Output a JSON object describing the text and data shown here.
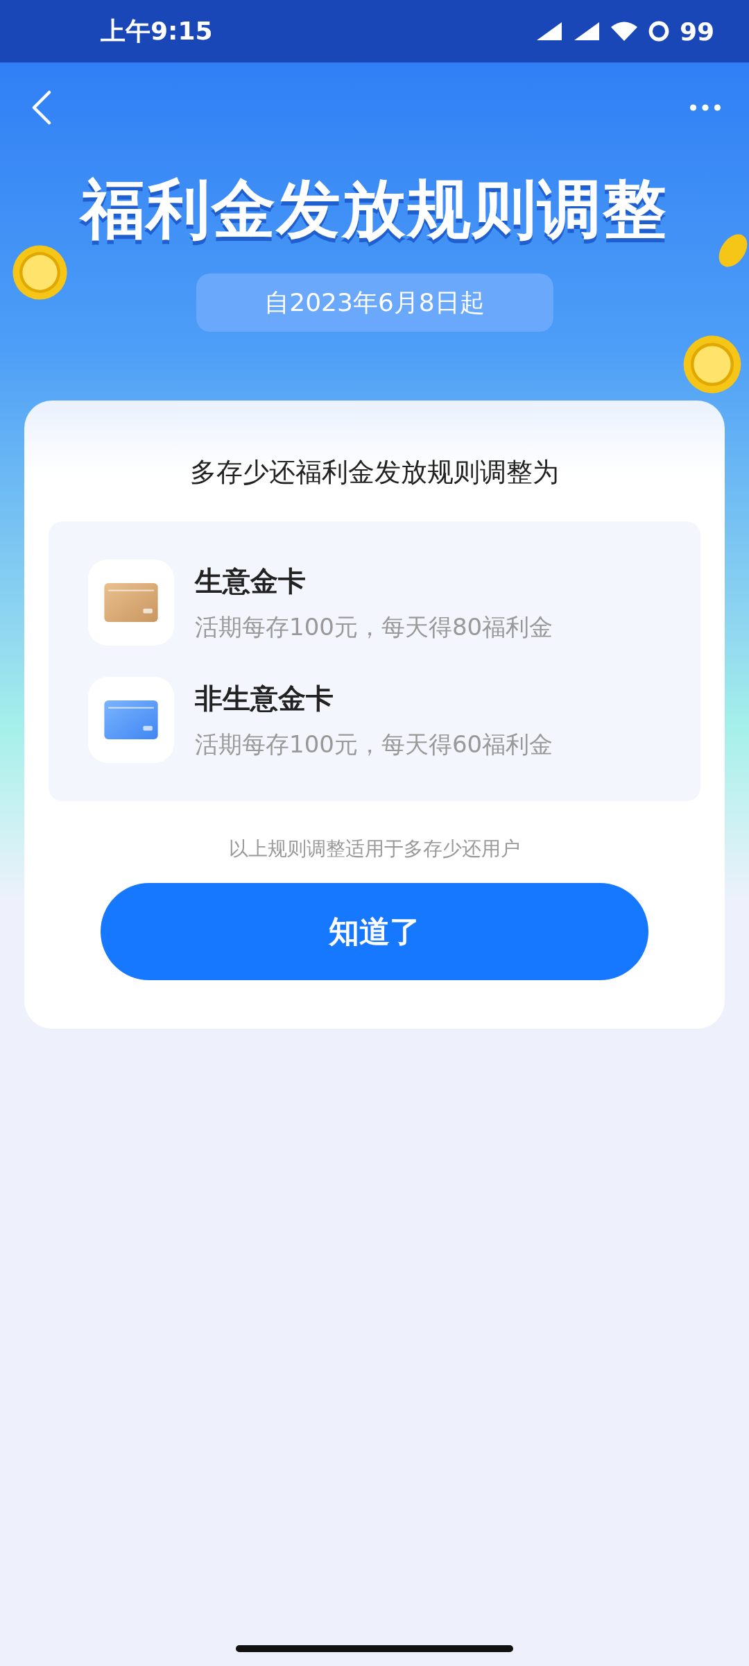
{
  "status_bar": {
    "time": "上午9:15",
    "battery": "99"
  },
  "title": "福利金发放规则调整",
  "date_badge": "自2023年6月8日起",
  "card": {
    "heading": "多存少还福利金发放规则调整为",
    "items": [
      {
        "kind": "gold",
        "name": "生意金卡",
        "desc": "活期每存100元，每天得80福利金"
      },
      {
        "kind": "blue",
        "name": "非生意金卡",
        "desc": "活期每存100元，每天得60福利金"
      }
    ],
    "note": "以上规则调整适用于多存少还用户",
    "button": "知道了"
  }
}
